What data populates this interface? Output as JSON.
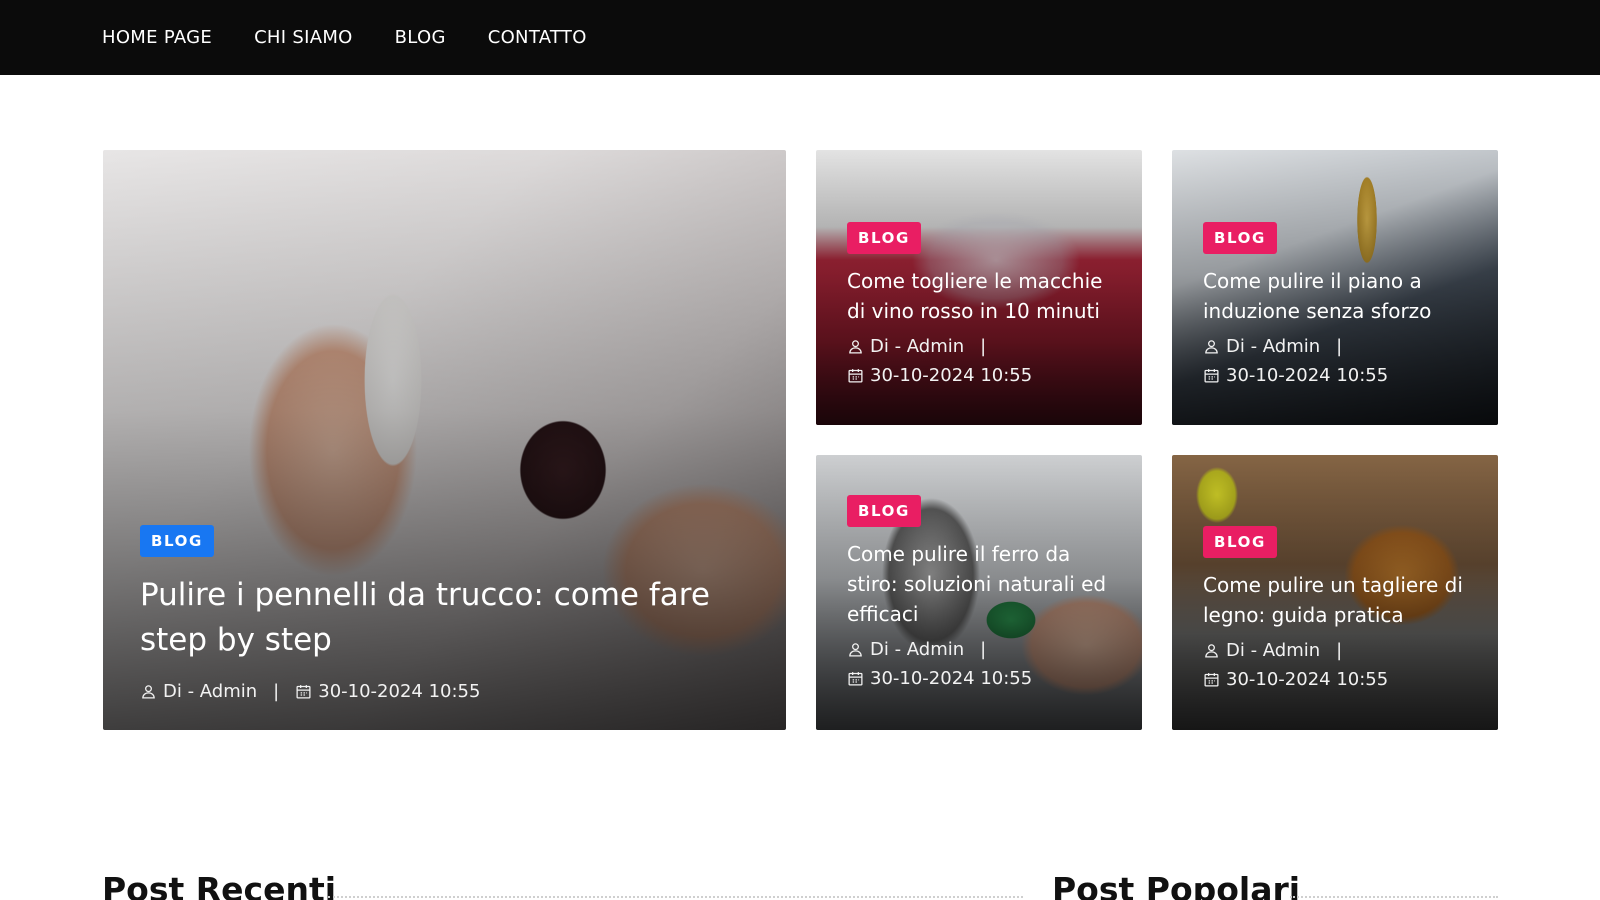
{
  "nav": {
    "items": [
      "HOME PAGE",
      "CHI SIAMO",
      "BLOG",
      "CONTATTO"
    ]
  },
  "featured": {
    "category": "BLOG",
    "category_color": "#1877f2",
    "title": "Pulire i pennelli da trucco: come fare step by step",
    "author": "Di - Admin",
    "separator": "|",
    "date": "30-10-2024 10:55"
  },
  "cards": [
    {
      "category": "BLOG",
      "category_color": "#e91e63",
      "title": "Come togliere le macchie di vino rosso in 10 minuti",
      "author": "Di - Admin",
      "separator": "|",
      "date": "30-10-2024 10:55"
    },
    {
      "category": "BLOG",
      "category_color": "#e91e63",
      "title": "Come pulire il piano a induzione senza sforzo",
      "author": "Di - Admin",
      "separator": "|",
      "date": "30-10-2024 10:55"
    },
    {
      "category": "BLOG",
      "category_color": "#e91e63",
      "title": "Come pulire il ferro da stiro: soluzioni naturali ed efficaci",
      "author": "Di - Admin",
      "separator": "|",
      "date": "30-10-2024 10:55"
    },
    {
      "category": "BLOG",
      "category_color": "#e91e63",
      "title": "Come pulire un tagliere di legno: guida pratica",
      "author": "Di - Admin",
      "separator": "|",
      "date": "30-10-2024 10:55"
    }
  ],
  "sections": {
    "recent_title": "Post Recenti",
    "popular_title": "Post Popolari"
  },
  "icons": {
    "author": "user-icon",
    "date": "calendar-icon"
  }
}
